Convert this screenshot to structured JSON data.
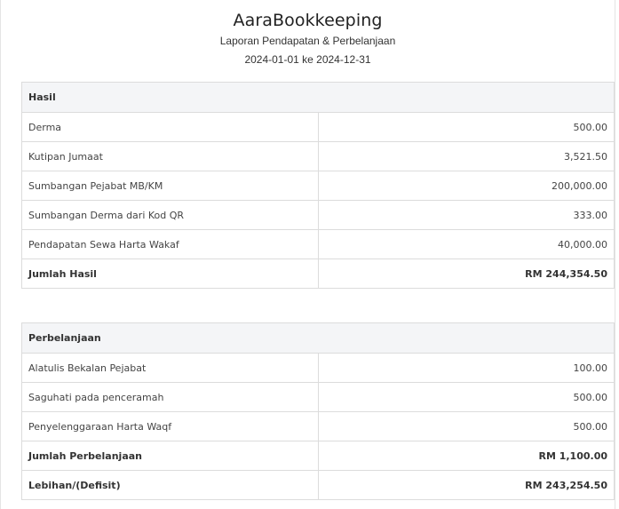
{
  "header": {
    "company": "AaraBookkeeping",
    "report_title": "Laporan Pendapatan & Perbelanjaan",
    "period": "2024-01-01 ke 2024-12-31"
  },
  "income": {
    "heading": "Hasil",
    "rows": [
      {
        "label": "Derma",
        "amount": "500.00"
      },
      {
        "label": "Kutipan Jumaat",
        "amount": "3,521.50"
      },
      {
        "label": "Sumbangan Pejabat MB/KM",
        "amount": "200,000.00"
      },
      {
        "label": "Sumbangan Derma dari Kod QR",
        "amount": "333.00"
      },
      {
        "label": "Pendapatan Sewa Harta Wakaf",
        "amount": "40,000.00"
      }
    ],
    "total_label": "Jumlah Hasil",
    "total_amount": "RM 244,354.50"
  },
  "expense": {
    "heading": "Perbelanjaan",
    "rows": [
      {
        "label": "Alatulis Bekalan Pejabat",
        "amount": "100.00"
      },
      {
        "label": "Saguhati pada penceramah",
        "amount": "500.00"
      },
      {
        "label": "Penyelenggaraan Harta Waqf",
        "amount": "500.00"
      }
    ],
    "total_label": "Jumlah Perbelanjaan",
    "total_amount": "RM 1,100.00"
  },
  "surplus": {
    "label": "Lebihan/(Defisit)",
    "amount": "RM 243,254.50"
  }
}
